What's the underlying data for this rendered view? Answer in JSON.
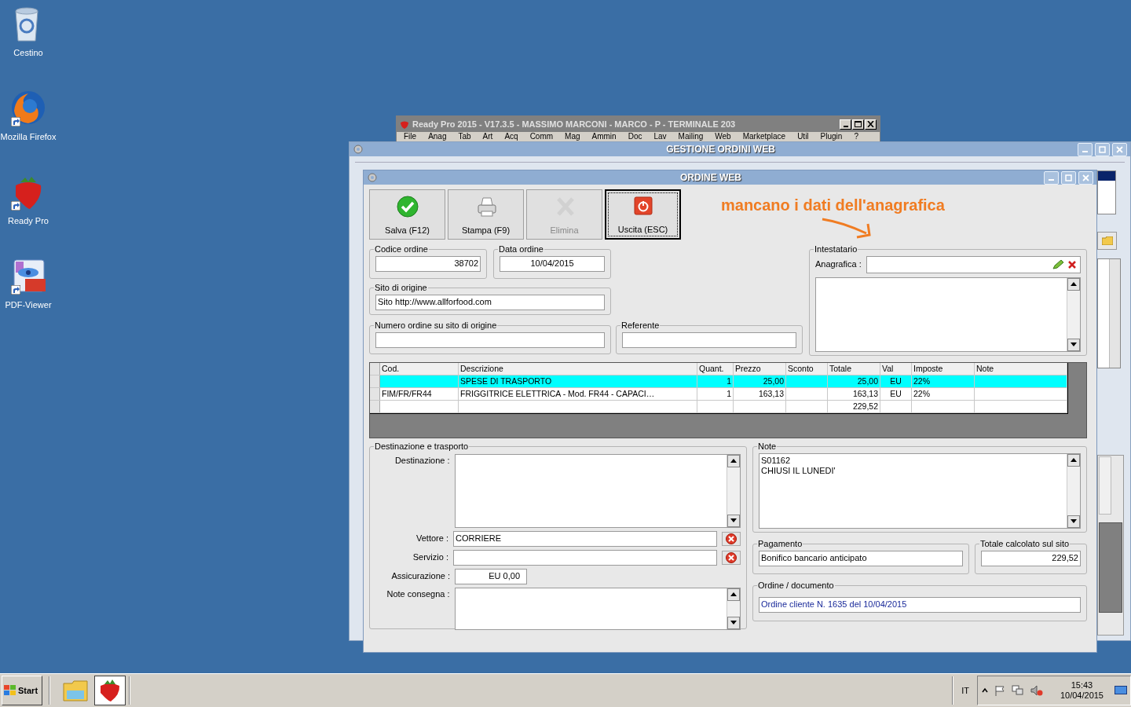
{
  "desktop_icons": [
    {
      "label": "Cestino",
      "kind": "trash",
      "shortcut": false
    },
    {
      "label": "Mozilla Firefox",
      "kind": "firefox",
      "shortcut": true
    },
    {
      "label": "Ready Pro",
      "kind": "strawberry",
      "shortcut": true
    },
    {
      "label": "PDF-Viewer",
      "kind": "pdf",
      "shortcut": true
    }
  ],
  "main_window": {
    "title": "Ready Pro 2015 - V17.3.5 - MASSIMO MARCONI - MARCO - P - TERMINALE 203",
    "menu": [
      "File",
      "Anag",
      "Tab",
      "Art",
      "Acq",
      "Comm",
      "Mag",
      "Ammin",
      "Doc",
      "Lav",
      "Mailing",
      "Web",
      "Marketplace",
      "Util",
      "Plugin",
      "?"
    ]
  },
  "manager_window": {
    "title": "GESTIONE ORDINI WEB"
  },
  "order_window": {
    "title": "ORDINE WEB",
    "toolbar": [
      {
        "label": "Salva (F12)",
        "kind": "save",
        "disabled": false,
        "focused": false
      },
      {
        "label": "Stampa (F9)",
        "kind": "print",
        "disabled": false,
        "focused": false
      },
      {
        "label": "Elimina",
        "kind": "delete",
        "disabled": true,
        "focused": false
      },
      {
        "label": "Uscita (ESC)",
        "kind": "exit",
        "disabled": false,
        "focused": true
      }
    ],
    "annotation": "mancano i dati dell'anagrafica",
    "codice_ordine": {
      "label": "Codice ordine",
      "value": "38702"
    },
    "data_ordine": {
      "label": "Data ordine",
      "value": "10/04/2015"
    },
    "sito_origine": {
      "label": "Sito di origine",
      "value": "Sito http://www.allforfood.com"
    },
    "numero_ordine_sito": {
      "label": "Numero ordine su sito di origine"
    },
    "referente": {
      "label": "Referente"
    },
    "intestatario": {
      "label": "Intestatario",
      "anagrafica_label": "Anagrafica :"
    },
    "table": {
      "columns": [
        "Cod.",
        "Descrizione",
        "Quant.",
        "Prezzo",
        "Sconto",
        "Totale",
        "Val",
        "Imposte",
        "Note"
      ],
      "rows": [
        {
          "selected": true,
          "cells": [
            null,
            "SPESE DI TRASPORTO",
            "1",
            "25,00",
            null,
            "25,00",
            "EU",
            "22%",
            null
          ]
        },
        {
          "selected": false,
          "cells": [
            "FIM/FR/FR44",
            "FRIGGITRICE ELETTRICA  - Mod. FR44 - CAPACI…",
            "1",
            "163,13",
            null,
            "163,13",
            "EU",
            "22%",
            null
          ]
        },
        {
          "selected": false,
          "cells": [
            null,
            null,
            null,
            null,
            null,
            "229,52",
            null,
            null,
            null
          ]
        }
      ]
    },
    "destinazione_trasporto": {
      "label": "Destinazione e trasporto",
      "destinazione_label": "Destinazione :",
      "vettore_label": "Vettore :",
      "vettore": "CORRIERE",
      "servizio_label": "Servizio :",
      "assicurazione_label": "Assicurazione :",
      "assicurazione": "EU 0,00",
      "note_consegna_label": "Note consegna :"
    },
    "note": {
      "label": "Note",
      "lines": [
        "S01162",
        "CHIUSI IL LUNEDI'"
      ]
    },
    "pagamento": {
      "label": "Pagamento",
      "value": "Bonifico bancario anticipato"
    },
    "totale_sito": {
      "label": "Totale calcolato sul sito",
      "value": "229,52"
    },
    "ordine_documento": {
      "label": "Ordine / documento",
      "value": "Ordine cliente N. 1635 del 10/04/2015"
    }
  },
  "taskbar": {
    "start": "Start",
    "language": "IT",
    "time": "15:43",
    "date": "10/04/2015"
  }
}
